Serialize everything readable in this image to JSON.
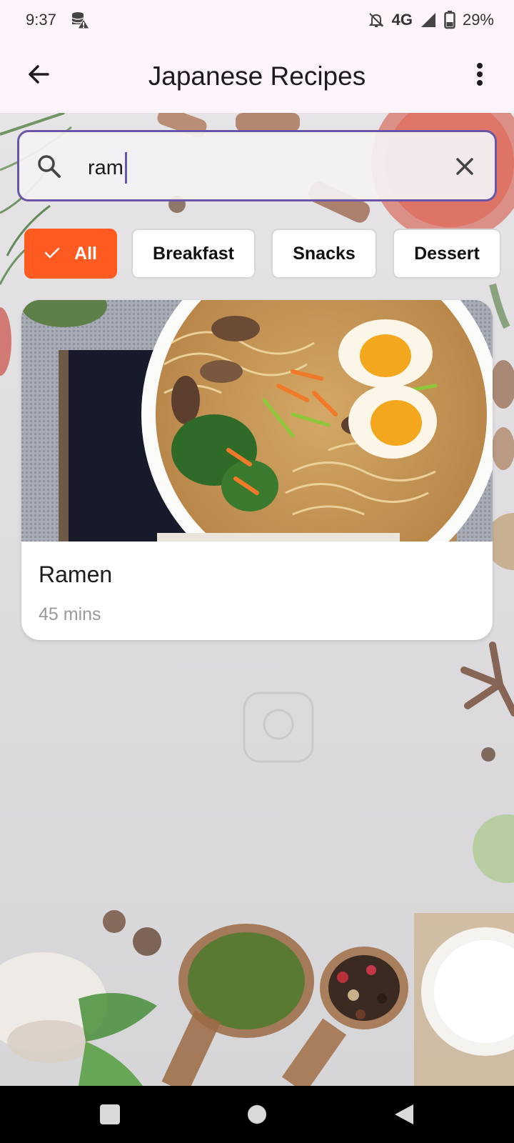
{
  "status_bar": {
    "time": "9:37",
    "network": "4G",
    "battery": "29%",
    "icons": [
      "storage-alert-icon",
      "bell-off-icon",
      "signal-icon",
      "battery-icon"
    ]
  },
  "app_bar": {
    "title": "Japanese Recipes",
    "icons": [
      "back-arrow-icon",
      "more-vert-icon"
    ]
  },
  "search": {
    "value": "ram",
    "icons": [
      "search-icon",
      "clear-icon"
    ],
    "accent_color": "#6a55a8"
  },
  "filters": {
    "chips": [
      {
        "label": "All",
        "selected": true
      },
      {
        "label": "Breakfast",
        "selected": false
      },
      {
        "label": "Snacks",
        "selected": false
      },
      {
        "label": "Dessert",
        "selected": false
      }
    ],
    "selected_color": "#ff5a20"
  },
  "results": [
    {
      "title": "Ramen",
      "time": "45 mins",
      "image": "ramen-bowl-photo"
    }
  ],
  "nav_bar": {
    "icons": [
      "recents-icon",
      "home-icon",
      "back-icon"
    ]
  }
}
